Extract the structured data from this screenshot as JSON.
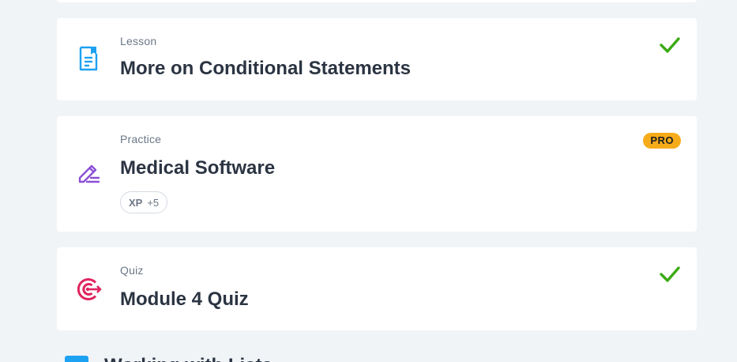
{
  "items": [
    {
      "kind": "Lesson",
      "title": "More on Conditional Statements",
      "icon": "lesson-document-icon",
      "completed": true
    },
    {
      "kind": "Practice",
      "title": "Medical Software",
      "icon": "practice-pencil-icon",
      "badge": "PRO",
      "xp_label": "XP",
      "xp_value": "+5"
    },
    {
      "kind": "Quiz",
      "title": "Module 4 Quiz",
      "icon": "quiz-target-icon",
      "completed": true
    }
  ],
  "next_section": {
    "title": "Working with Lists"
  },
  "colors": {
    "background": "#f1f4f7",
    "lesson_icon": "#1da1f2",
    "practice_icon": "#8a4fd6",
    "quiz_icon": "#e0245e",
    "check": "#3caa13",
    "pro_badge": "#f6ab1a"
  }
}
